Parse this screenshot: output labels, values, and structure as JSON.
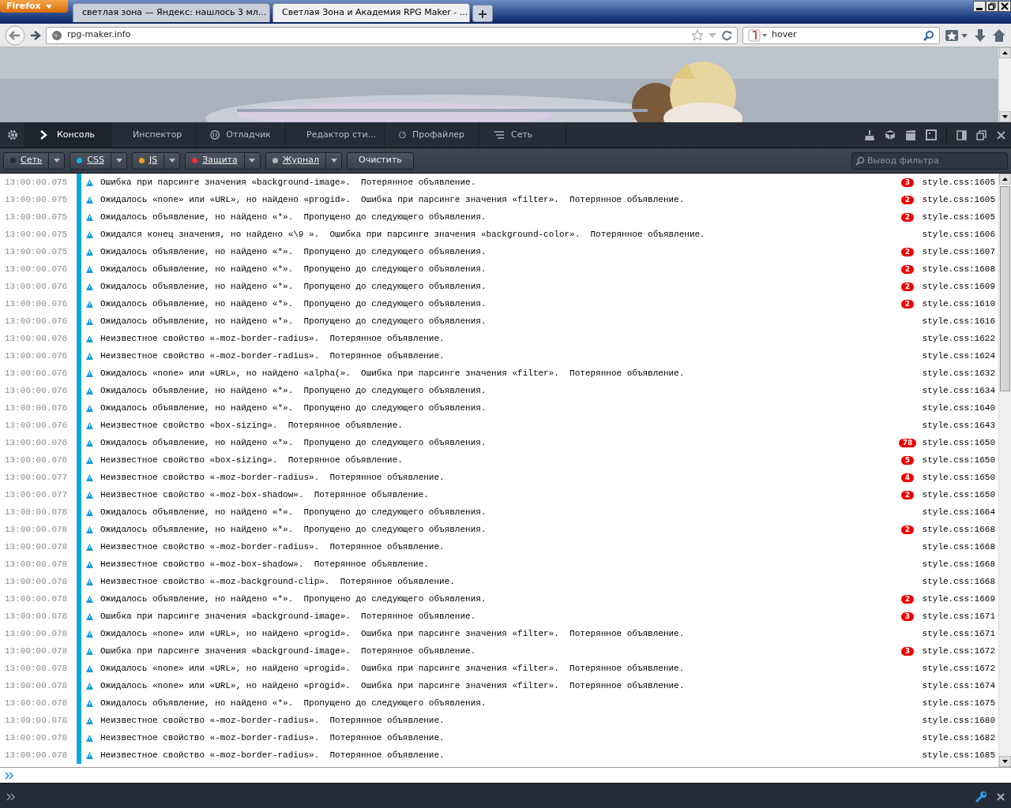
{
  "browser": {
    "app_menu": "Firefox",
    "tabs": [
      {
        "title": "светлая зона — Яндекс: нашлось 3 мл...",
        "selected": false
      },
      {
        "title": "Светлая Зона и Академия RPG Maker - ...",
        "selected": true
      }
    ],
    "url": "rpg-maker.info",
    "search": {
      "value": "hover"
    }
  },
  "devtools": {
    "tabs": [
      {
        "label": "Консоль",
        "selected": true
      },
      {
        "label": "Инспектор",
        "selected": false
      },
      {
        "label": "Отладчик",
        "selected": false
      },
      {
        "label": "Редактор сти...",
        "selected": false
      },
      {
        "label": "Профайлер",
        "selected": false
      },
      {
        "label": "Сеть",
        "selected": false
      }
    ],
    "filters": [
      {
        "label": "Сеть",
        "color": "#2a2a2a"
      },
      {
        "label": "CSS",
        "color": "#1ab2e8"
      },
      {
        "label": "JS",
        "color": "#f09a20"
      },
      {
        "label": "Защита",
        "color": "#ee3333"
      },
      {
        "label": "Журнал",
        "color": "#b4b4b4"
      }
    ],
    "clear_button": "Очистить",
    "filter_field": {
      "placeholder": "Вывод фильтра"
    }
  },
  "console": {
    "messages": [
      {
        "time": "13:00:00.075",
        "text": "Ошибка при парсинге значения «background-image».  Потерянное объявление.",
        "count": "3",
        "source": "style.css:1605"
      },
      {
        "time": "13:00:00.075",
        "text": "Ожидалось «none» или «URL», но найдено «progid».  Ошибка при парсинге значения «filter».  Потерянное объявление.",
        "count": "2",
        "source": "style.css:1605"
      },
      {
        "time": "13:00:00.075",
        "text": "Ожидалось объявление, но найдено «*».  Пропущено до следующего объявления.",
        "count": "2",
        "source": "style.css:1605"
      },
      {
        "time": "13:00:00.075",
        "text": "Ожидался конец значения, но найдено «\\9 ».  Ошибка при парсинге значения «background-color».  Потерянное объявление.",
        "source": "style.css:1606"
      },
      {
        "time": "13:00:00.075",
        "text": "Ожидалось объявление, но найдено «*».  Пропущено до следующего объявления.",
        "count": "2",
        "source": "style.css:1607"
      },
      {
        "time": "13:00:00.076",
        "text": "Ожидалось объявление, но найдено «*».  Пропущено до следующего объявления.",
        "count": "2",
        "source": "style.css:1608"
      },
      {
        "time": "13:00:00.076",
        "text": "Ожидалось объявление, но найдено «*».  Пропущено до следующего объявления.",
        "count": "2",
        "source": "style.css:1609"
      },
      {
        "time": "13:00:00.076",
        "text": "Ожидалось объявление, но найдено «*».  Пропущено до следующего объявления.",
        "count": "2",
        "source": "style.css:1610"
      },
      {
        "time": "13:00:00.076",
        "text": "Ожидалось объявление, но найдено «*».  Пропущено до следующего объявления.",
        "source": "style.css:1616"
      },
      {
        "time": "13:00:00.076",
        "text": "Неизвестное свойство «-moz-border-radius».  Потерянное объявление.",
        "source": "style.css:1622"
      },
      {
        "time": "13:00:00.076",
        "text": "Неизвестное свойство «-moz-border-radius».  Потерянное объявление.",
        "source": "style.css:1624"
      },
      {
        "time": "13:00:00.076",
        "text": "Ожидалось «none» или «URL», но найдено «alpha(».  Ошибка при парсинге значения «filter».  Потерянное объявление.",
        "source": "style.css:1632"
      },
      {
        "time": "13:00:00.076",
        "text": "Ожидалось объявление, но найдено «*».  Пропущено до следующего объявления.",
        "source": "style.css:1634"
      },
      {
        "time": "13:00:00.076",
        "text": "Ожидалось объявление, но найдено «*».  Пропущено до следующего объявления.",
        "source": "style.css:1640"
      },
      {
        "time": "13:00:00.076",
        "text": "Неизвестное свойство «box-sizing».  Потерянное объявление.",
        "source": "style.css:1643"
      },
      {
        "time": "13:00:00.076",
        "text": "Ожидалось объявление, но найдено «*».  Пропущено до следующего объявления.",
        "count": "78",
        "source": "style.css:1650"
      },
      {
        "time": "13:00:00.076",
        "text": "Неизвестное свойство «box-sizing».  Потерянное объявление.",
        "count": "5",
        "source": "style.css:1650"
      },
      {
        "time": "13:00:00.077",
        "text": "Неизвестное свойство «-moz-border-radius».  Потерянное объявление.",
        "count": "4",
        "source": "style.css:1650"
      },
      {
        "time": "13:00:00.077",
        "text": "Неизвестное свойство «-moz-box-shadow».  Потерянное объявление.",
        "count": "2",
        "source": "style.css:1650"
      },
      {
        "time": "13:00:00.078",
        "text": "Ожидалось объявление, но найдено «*».  Пропущено до следующего объявления.",
        "source": "style.css:1664"
      },
      {
        "time": "13:00:00.078",
        "text": "Ожидалось объявление, но найдено «*».  Пропущено до следующего объявления.",
        "count": "2",
        "source": "style.css:1668"
      },
      {
        "time": "13:00:00.078",
        "text": "Неизвестное свойство «-moz-border-radius».  Потерянное объявление.",
        "source": "style.css:1668"
      },
      {
        "time": "13:00:00.078",
        "text": "Неизвестное свойство «-moz-box-shadow».  Потерянное объявление.",
        "source": "style.css:1668"
      },
      {
        "time": "13:00:00.078",
        "text": "Неизвестное свойство «-moz-background-clip».  Потерянное объявление.",
        "source": "style.css:1668"
      },
      {
        "time": "13:00:00.078",
        "text": "Ожидалось объявление, но найдено «*».  Пропущено до следующего объявления.",
        "count": "2",
        "source": "style.css:1669"
      },
      {
        "time": "13:00:00.078",
        "text": "Ошибка при парсинге значения «background-image».  Потерянное объявление.",
        "count": "3",
        "source": "style.css:1671"
      },
      {
        "time": "13:00:00.078",
        "text": "Ожидалось «none» или «URL», но найдено «progid».  Ошибка при парсинге значения «filter».  Потерянное объявление.",
        "source": "style.css:1671"
      },
      {
        "time": "13:00:00.078",
        "text": "Ошибка при парсинге значения «background-image».  Потерянное объявление.",
        "count": "3",
        "source": "style.css:1672"
      },
      {
        "time": "13:00:00.078",
        "text": "Ожидалось «none» или «URL», но найдено «progid».  Ошибка при парсинге значения «filter».  Потерянное объявление.",
        "source": "style.css:1672"
      },
      {
        "time": "13:00:00.078",
        "text": "Ожидалось «none» или «URL», но найдено «progid».  Ошибка при парсинге значения «filter».  Потерянное объявление.",
        "source": "style.css:1674"
      },
      {
        "time": "13:00:00.078",
        "text": "Ожидалось объявление, но найдено «*».  Пропущено до следующего объявления.",
        "source": "style.css:1675"
      },
      {
        "time": "13:00:00.078",
        "text": "Неизвестное свойство «-moz-border-radius».  Потерянное объявление.",
        "source": "style.css:1680"
      },
      {
        "time": "13:00:00.078",
        "text": "Неизвестное свойство «-moz-border-radius».  Потерянное объявление.",
        "source": "style.css:1682"
      },
      {
        "time": "13:00:00.078",
        "text": "Неизвестное свойство «-moz-border-radius».  Потерянное объявление.",
        "source": "style.css:1685"
      }
    ]
  }
}
